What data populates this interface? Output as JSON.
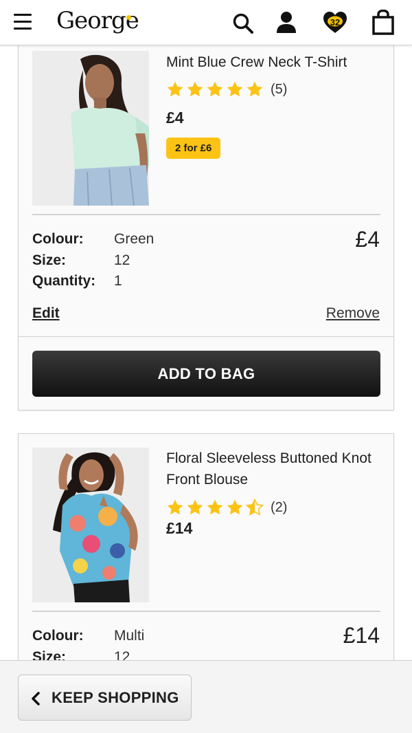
{
  "header": {
    "logo_text": "George",
    "favourites_count": "32",
    "icons": [
      "menu-icon",
      "search-icon",
      "account-icon",
      "favourites-heart-icon",
      "bag-icon"
    ],
    "accent_color": "#f5c400"
  },
  "items": [
    {
      "name": "Mint Blue Crew Neck T-Shirt",
      "rating": 5,
      "review_count": "(5)",
      "price": "£4",
      "promo": "2 for £6",
      "attributes": [
        {
          "label": "Colour:",
          "value": "Green"
        },
        {
          "label": "Size:",
          "value": "12"
        },
        {
          "label": "Quantity:",
          "value": "1"
        }
      ],
      "line_price": "£4",
      "edit_label": "Edit",
      "remove_label": "Remove",
      "add_to_bag_label": "ADD TO BAG"
    },
    {
      "name": "Floral Sleeveless Buttoned Knot Front Blouse",
      "rating": 4.5,
      "review_count": "(2)",
      "price": "£14",
      "attributes": [
        {
          "label": "Colour:",
          "value": "Multi"
        },
        {
          "label": "Size:",
          "value": "12"
        }
      ],
      "line_price": "£14"
    }
  ],
  "footer": {
    "keep_shopping_label": "KEEP SHOPPING"
  },
  "colors": {
    "star": "#fcc315",
    "promo_badge": "#fcc315",
    "primary_button": "#1a1a1a"
  }
}
